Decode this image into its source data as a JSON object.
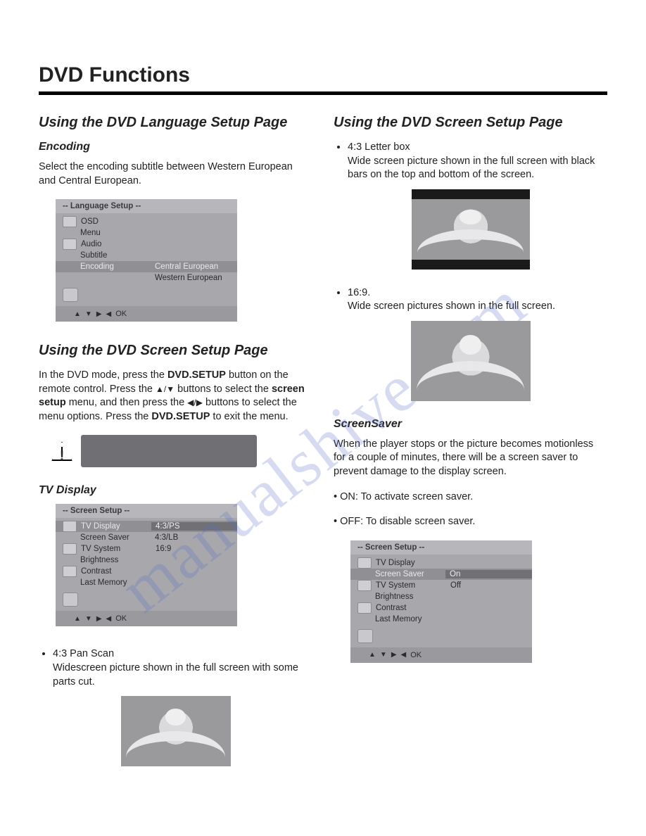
{
  "watermark": "manualshive.com",
  "page_title": "DVD Functions",
  "left": {
    "section1_title": "Using the DVD Language Setup Page",
    "encoding_heading": "Encoding",
    "encoding_text": "Select the encoding subtitle between Western European and Central European.",
    "lang_menu": {
      "title": "--  Language  Setup  --",
      "rows": [
        {
          "label": "OSD",
          "icon": true
        },
        {
          "label": "Menu"
        },
        {
          "label": "Audio",
          "icon": true
        },
        {
          "label": "Subtitle"
        },
        {
          "label": "Encoding",
          "opt": "Central European",
          "sel": true
        },
        {
          "label": "",
          "opt": "Western European"
        }
      ],
      "footer_ok": "OK"
    },
    "section2_title": "Using the DVD Screen Setup Page",
    "screen_intro_1": "In the DVD mode, press the ",
    "screen_intro_b1": "DVD.SETUP",
    "screen_intro_2": " button on the remote control. Press the ",
    "screen_intro_updown": "▲/▼",
    "screen_intro_3": " buttons to select the ",
    "screen_intro_b2": "screen setup",
    "screen_intro_4": " menu, and then press the ",
    "screen_intro_lr": "◀/▶",
    "screen_intro_5": " buttons to select the menu options. Press the ",
    "screen_intro_b3": "DVD.SETUP",
    "screen_intro_6": " to exit the menu.",
    "tv_display_heading": "TV Display",
    "screen_menu1": {
      "title": "--  Screen  Setup  --",
      "rows": [
        {
          "label": "TV Display",
          "opt": "4:3/PS",
          "icon": true,
          "sel": true,
          "optsel": true
        },
        {
          "label": "Screen Saver",
          "opt": "4:3/LB"
        },
        {
          "label": "TV System",
          "opt": "16:9",
          "icon": true
        },
        {
          "label": "Brightness"
        },
        {
          "label": "Contrast",
          "icon": true
        },
        {
          "label": "Last Memory"
        }
      ],
      "footer_ok": "OK"
    },
    "bullet_pan_title": "4:3 Pan Scan",
    "bullet_pan_desc": "Widescreen picture shown in the full screen with some parts cut."
  },
  "right": {
    "section_title": "Using the DVD Screen Setup Page",
    "bullet_lb_title": "4:3 Letter box",
    "bullet_lb_desc": "Wide screen picture shown in the full screen with black bars on the top and bottom of the screen.",
    "bullet_169_title": "16:9.",
    "bullet_169_desc": "Wide screen pictures shown in the full screen.",
    "ss_heading": "ScreenSaver",
    "ss_text": "When the player stops or the picture becomes motionless for a couple of minutes, there will be a screen saver to prevent damage to the display screen.",
    "ss_on": "• ON: To activate screen saver.",
    "ss_off": "• OFF: To disable screen saver.",
    "screen_menu2": {
      "title": "--  Screen  Setup  --",
      "rows": [
        {
          "label": "TV Display",
          "icon": true
        },
        {
          "label": "Screen Saver",
          "opt": "On",
          "sel": true,
          "optsel": true
        },
        {
          "label": "TV System",
          "opt": "Off",
          "icon": true
        },
        {
          "label": "Brightness"
        },
        {
          "label": "Contrast",
          "icon": true
        },
        {
          "label": "Last Memory"
        }
      ],
      "footer_ok": "OK"
    }
  }
}
